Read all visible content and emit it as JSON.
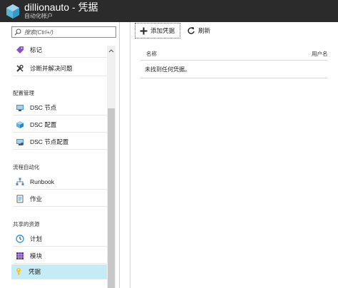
{
  "header": {
    "title": "dillionauto - 凭据",
    "subtitle": "自动化帐户",
    "colors": {
      "background": "#2b2b2b",
      "logo": "#59b4d9"
    }
  },
  "left_blade": {
    "search_placeholder": "搜索(Ctrl+/)",
    "items": [
      {
        "label": "标记",
        "icon": "tag-icon"
      },
      {
        "label": "诊断并解决问题",
        "icon": "wrench-icon"
      }
    ],
    "sections": [
      {
        "label": "配置管理",
        "items": [
          {
            "label": "DSC 节点",
            "icon": "monitor-icon"
          },
          {
            "label": "DSC 配置",
            "icon": "cube-icon"
          },
          {
            "label": "DSC 节点配置",
            "icon": "monitor-config-icon"
          }
        ]
      },
      {
        "label": "流程自动化",
        "items": [
          {
            "label": "Runbook",
            "icon": "runbook-icon"
          },
          {
            "label": "作业",
            "icon": "jobs-icon"
          }
        ]
      },
      {
        "label": "共享的资源",
        "items": [
          {
            "label": "计划",
            "icon": "clock-icon"
          },
          {
            "label": "模块",
            "icon": "grid-icon"
          },
          {
            "label": "凭据",
            "icon": "key-icon",
            "selected": true
          }
        ]
      }
    ],
    "colors": {
      "selected_background": "#c5ebf7"
    }
  },
  "right_blade": {
    "toolbar": {
      "add_label": "添加凭据",
      "refresh_label": "刷新"
    },
    "table": {
      "columns": [
        "名称",
        "用户名"
      ],
      "empty_message": "未找到任何凭据。"
    }
  }
}
